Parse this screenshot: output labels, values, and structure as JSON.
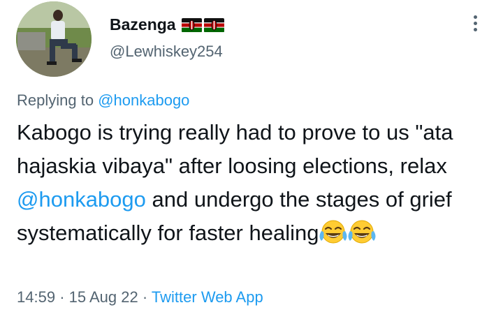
{
  "tweet": {
    "author": {
      "display_name": "Bazenga",
      "handle": "@Lewhiskey254",
      "badge_icons": [
        "kenya-flag-icon",
        "kenya-flag-icon"
      ]
    },
    "replying_prefix": "Replying to",
    "replying_to": "@honkabogo",
    "body": {
      "part1": "Kabogo is trying really had to prove to us \"ata hajaskia vibaya\" after loosing elections, relax ",
      "mention": "@honkabogo",
      "part2": " and undergo the stages of grief systematically for faster healing",
      "emoji_icons": [
        "tears-of-joy-emoji-icon",
        "tears-of-joy-emoji-icon"
      ]
    },
    "time": "14:59",
    "separator": "·",
    "date": "15 Aug 22",
    "source": "Twitter Web App"
  },
  "colors": {
    "text": "#0f1419",
    "secondary": "#536471",
    "link": "#1d9bf0"
  }
}
